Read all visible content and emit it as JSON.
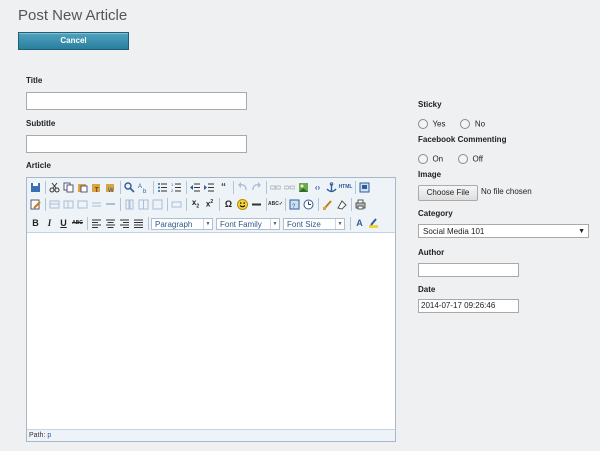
{
  "page": {
    "title": "Post New Article"
  },
  "actions": {
    "cancel_label": "Cancel"
  },
  "form": {
    "title_label": "Title",
    "subtitle_label": "Subtitle",
    "article_label": "Article",
    "sticky_label": "Sticky",
    "sticky_options": [
      "Yes",
      "No"
    ],
    "facebook_label": "Facebook Commenting",
    "facebook_options": [
      "On",
      "Off"
    ],
    "image_label": "Image",
    "choose_file_label": "Choose File",
    "no_file_text": "No file chosen",
    "category_label": "Category",
    "category_value": "Social Media 101",
    "author_label": "Author",
    "author_value": "",
    "date_label": "Date",
    "date_value": "2014-07-17 09:26:46"
  },
  "editor": {
    "paragraph_select": "Paragraph",
    "font_family_select": "Font Family",
    "font_size_select": "Font Size",
    "path_label": "Path:",
    "path_value": "p",
    "toolbar_row1_icons": [
      "save-icon",
      "cut-icon",
      "copy-icon",
      "paste-icon",
      "paste-text-icon",
      "paste-word-icon",
      "find-icon",
      "replace-icon",
      "bullet-list-icon",
      "numbered-list-icon",
      "outdent-icon",
      "indent-icon",
      "blockquote-icon",
      "undo-icon",
      "redo-icon",
      "link-icon",
      "unlink-icon",
      "image-icon",
      "code-icon",
      "anchor-icon",
      "html-icon",
      "preview-icon"
    ],
    "toolbar_row2_icons": [
      "edit-css-icon",
      "table-icon",
      "row-props-icon",
      "cell-props-icon",
      "insert-row-icon",
      "delete-row-icon",
      "col-icon",
      "split-icon",
      "merge-icon",
      "hr-icon",
      "subscript-icon",
      "superscript-icon",
      "omega-icon",
      "emoticon-icon",
      "hr-line-icon",
      "spellcheck-icon",
      "media-icon",
      "time-icon",
      "cleanup-icon",
      "remove-format-icon",
      "print-icon"
    ],
    "toolbar_row3_icons": [
      "bold-icon",
      "italic-icon",
      "underline-icon",
      "strikethrough-icon",
      "align-left-icon",
      "align-center-icon",
      "align-right-icon",
      "justify-icon",
      "text-color-icon",
      "highlight-icon"
    ]
  }
}
